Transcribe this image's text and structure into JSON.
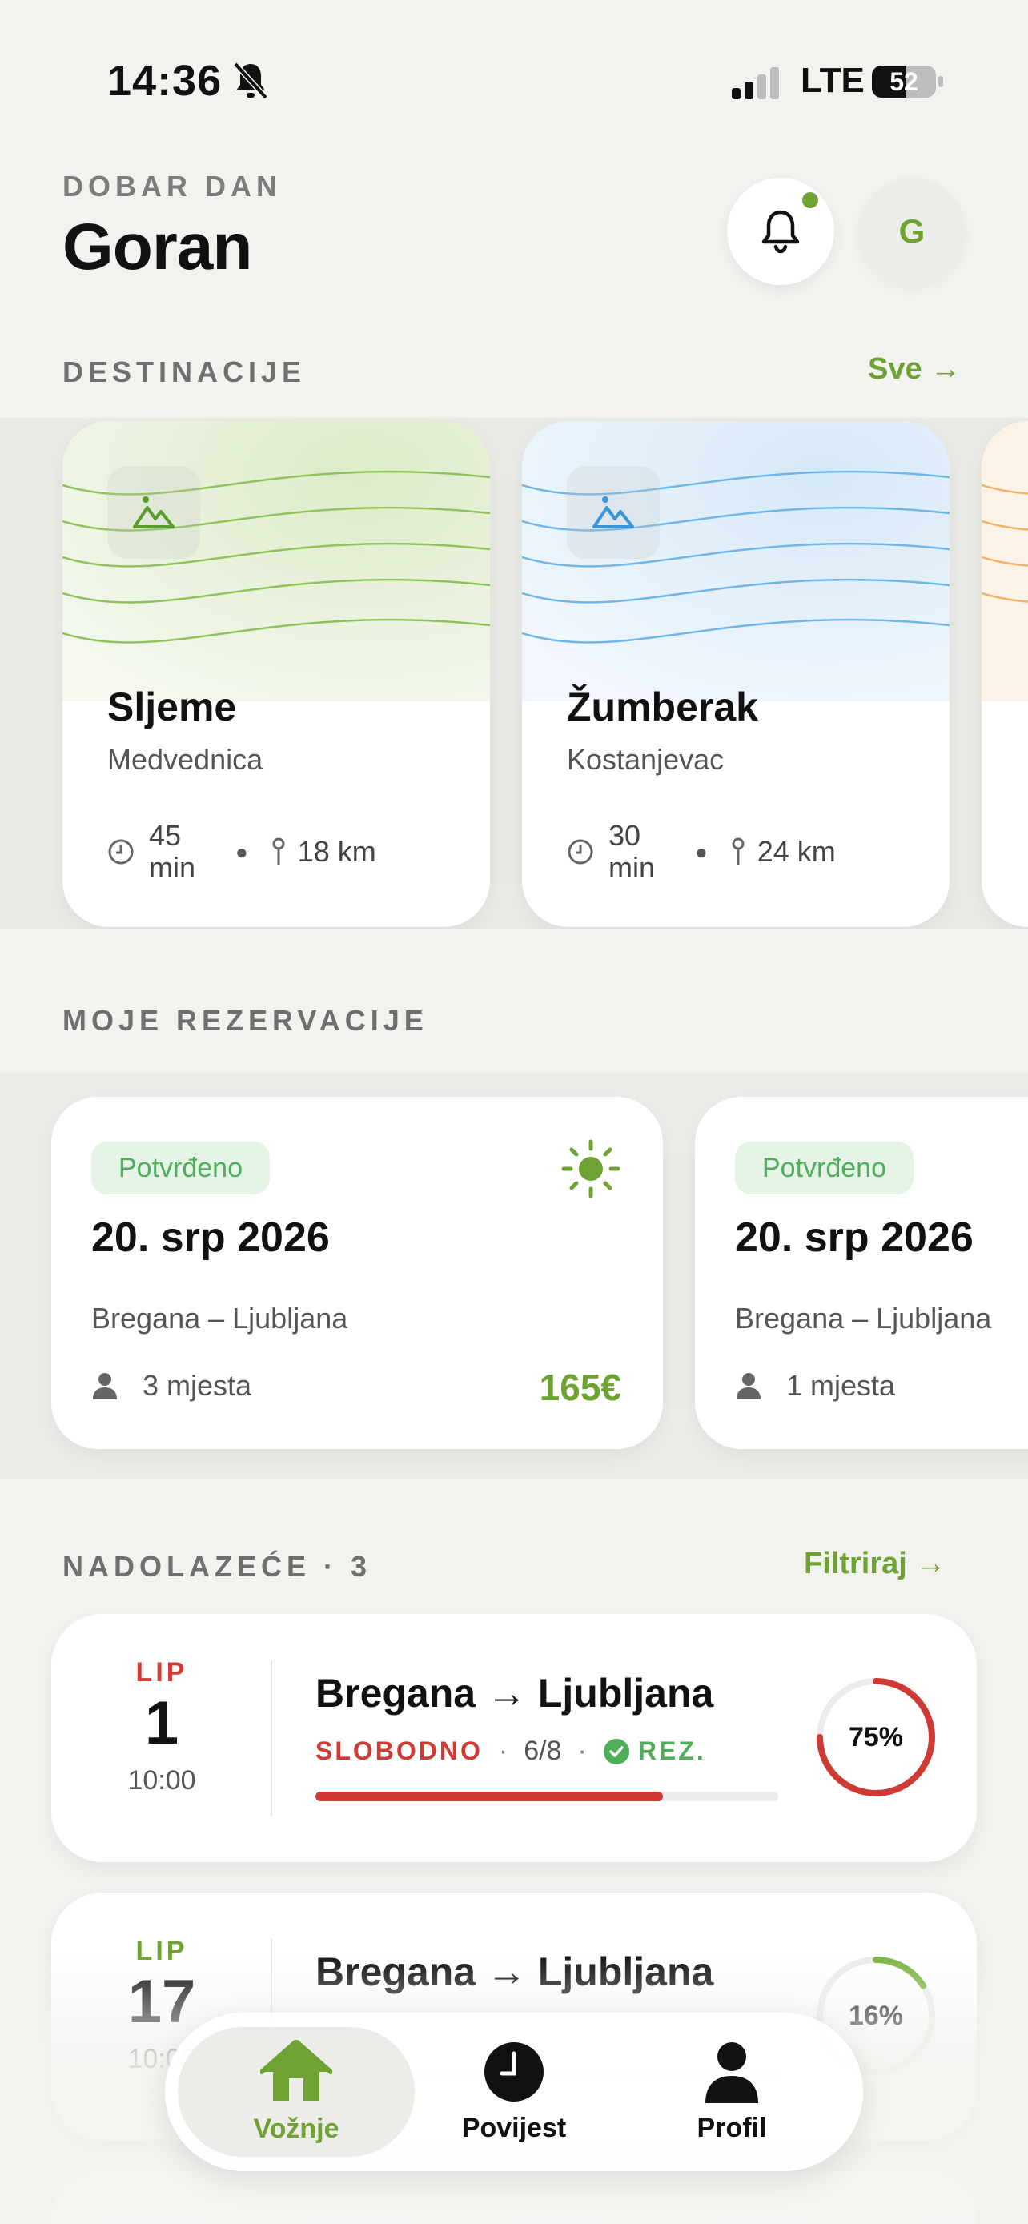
{
  "status": {
    "time": "14:36",
    "network": "LTE",
    "battery": "52"
  },
  "header": {
    "greeting": "DOBAR DAN",
    "name": "Goran",
    "avatar_initial": "G"
  },
  "destinations": {
    "title": "DESTINACIJE",
    "link": "Sve →",
    "items": [
      {
        "name": "Sljeme",
        "region": "Medvednica",
        "duration": "45 min",
        "distance": "18 km",
        "accent": "#7cb342"
      },
      {
        "name": "Žumberak",
        "region": "Kostanjevac",
        "duration": "30 min",
        "distance": "24 km",
        "accent": "#4aa3df"
      }
    ]
  },
  "reservations": {
    "title": "MOJE REZERVACIJE",
    "items": [
      {
        "status": "Potvrđeno",
        "date": "20. srp 2026",
        "route": "Bregana – Ljubljana",
        "seats": "3 mjesta",
        "price": "165€"
      },
      {
        "status": "Potvrđeno",
        "date": "20. srp 2026",
        "route": "Bregana – Ljubljana",
        "seats": "1 mjesta"
      }
    ]
  },
  "upcoming": {
    "title": "NADOLAZEĆE · 3",
    "link": "Filtriraj →",
    "rides": [
      {
        "month": "LIP",
        "day": "1",
        "time": "10:00",
        "route": "Bregana → Ljubljana",
        "availability": "SLOBODNO",
        "seats": "6/8",
        "reserved": "REZ.",
        "fill": 0.75,
        "percent": "75%",
        "color": "#d03a35"
      },
      {
        "month": "LIP",
        "day": "17",
        "time": "10:00",
        "route": "Bregana → Ljubljana",
        "fill": 0.16,
        "percent": "16%",
        "color": "#7cb342"
      }
    ]
  },
  "nav": {
    "items": [
      {
        "label": "Vožnje",
        "icon": "home-icon",
        "active": true
      },
      {
        "label": "Povijest",
        "icon": "clock-icon"
      },
      {
        "label": "Profil",
        "icon": "person-icon"
      }
    ]
  }
}
